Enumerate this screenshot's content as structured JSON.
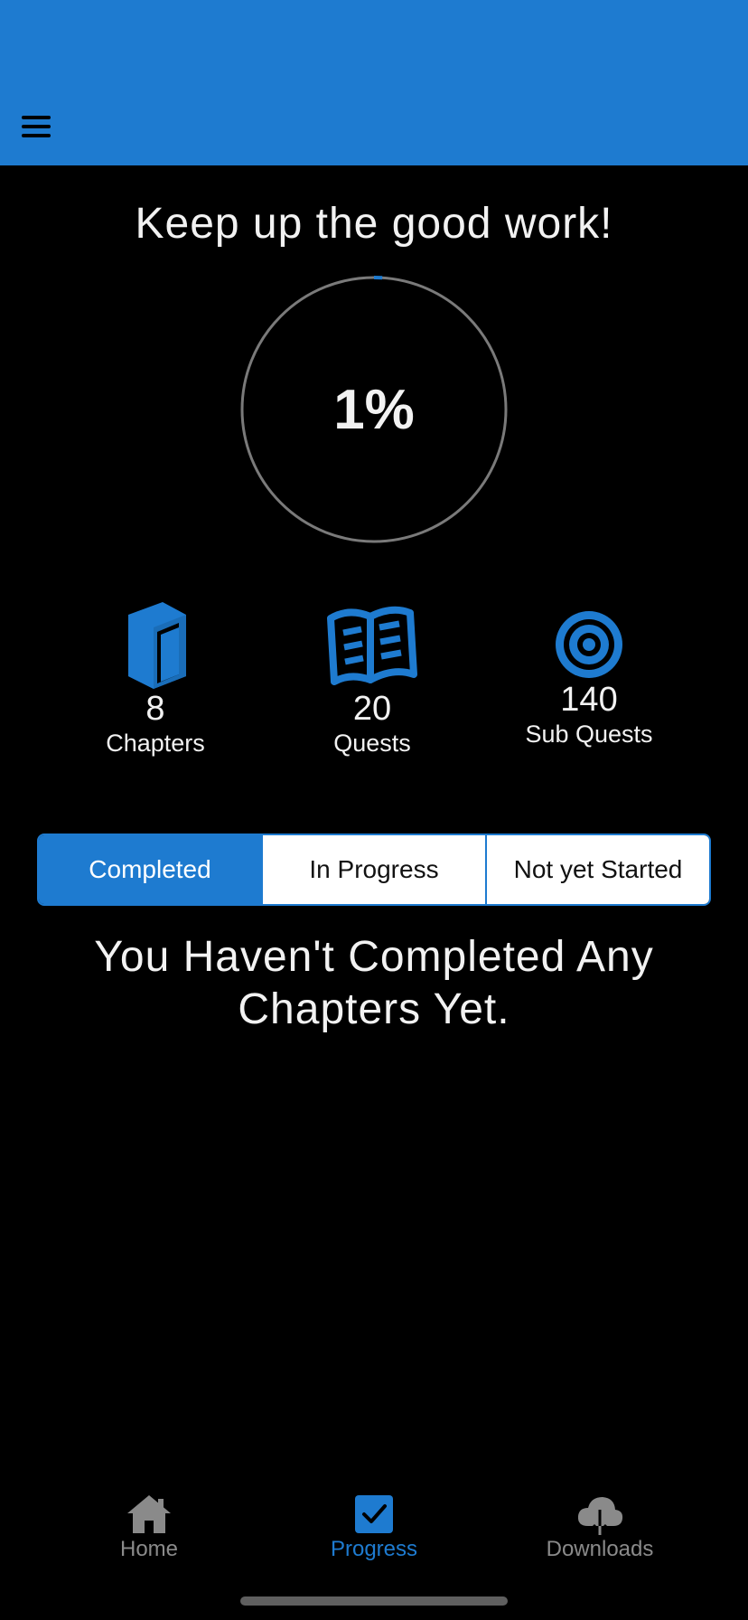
{
  "header": {
    "color": "#1e7bd0",
    "menu_icon": "hamburger-menu-icon"
  },
  "headline": "Keep up the good work!",
  "progress": {
    "percent_label": "1%",
    "fraction": 0.01
  },
  "stats": [
    {
      "icon": "book-icon",
      "value": "8",
      "label": "Chapters"
    },
    {
      "icon": "open-book-icon",
      "value": "20",
      "label": "Quests"
    },
    {
      "icon": "target-icon",
      "value": "140",
      "label": "Sub Quests"
    }
  ],
  "segments": {
    "items": [
      "Completed",
      "In Progress",
      "Not yet Started"
    ],
    "selected": "Completed"
  },
  "empty_message": "You Haven't Completed Any Chapters Yet.",
  "tabbar": {
    "items": [
      {
        "icon": "home-icon",
        "label": "Home"
      },
      {
        "icon": "checkbox-icon",
        "label": "Progress"
      },
      {
        "icon": "cloud-download-icon",
        "label": "Downloads"
      }
    ],
    "selected": "Progress"
  },
  "colors": {
    "accent": "#1e7bd0",
    "background": "#000000",
    "ring": "#7a7a7a",
    "tab_inactive": "#8a8a8a"
  }
}
